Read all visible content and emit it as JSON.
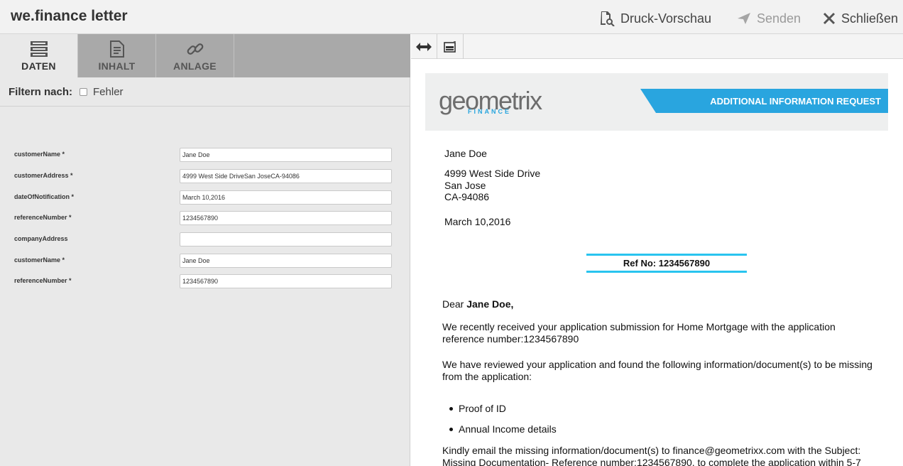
{
  "app": {
    "title": "we.finance letter"
  },
  "header": {
    "preview_label": "Druck-Vorschau",
    "send_label": "Senden",
    "close_label": "Schließen"
  },
  "tabs": [
    {
      "label": "DATEN",
      "icon": "database-icon",
      "active": true
    },
    {
      "label": "INHALT",
      "icon": "document-icon",
      "active": false
    },
    {
      "label": "ANLAGE",
      "icon": "link-icon",
      "active": false
    }
  ],
  "filter": {
    "label": "Filtern nach:",
    "option": "Fehler",
    "checked": false
  },
  "form": {
    "fields": [
      {
        "label": "customerName *",
        "value": "Jane Doe"
      },
      {
        "label": "customerAddress *",
        "value": "4999 West Side DriveSan JoseCA-94086"
      },
      {
        "label": "dateOfNotification *",
        "value": "March 10,2016"
      },
      {
        "label": "referenceNumber *",
        "value": "1234567890"
      },
      {
        "label": "companyAddress",
        "value": ""
      },
      {
        "label": "customerName *",
        "value": "Jane Doe"
      },
      {
        "label": "referenceNumber *",
        "value": "1234567890"
      }
    ]
  },
  "letter": {
    "logo_text": "geometrix",
    "logo_sub": "FINANCE",
    "banner_title": "ADDITIONAL INFORMATION REQUEST",
    "recipient_name": "Jane Doe",
    "address_line1": "4999 West Side Drive",
    "address_line2": "San Jose",
    "address_line3": "CA-94086",
    "date": "March 10,2016",
    "ref": "Ref No: 1234567890",
    "salutation_prefix": "Dear ",
    "salutation_name": "Jane Doe,",
    "paragraph1": "We recently received your application submission for Home Mortgage with the application reference number:1234567890",
    "paragraph2": "We have reviewed your application and found the following information/document(s) to be missing from the application:",
    "missing_items": [
      "Proof of ID",
      "Annual Income details"
    ],
    "paragraph3": "Kindly email the missing information/document(s) to finance@geometrixx.com with the Subject: Missing Documentation- Reference number:1234567890, to complete the application within 5-7"
  },
  "colors": {
    "accent": "#29a5df",
    "ref_border": "#29c4ef",
    "tab_bar": "#a9a9a9",
    "panel_bg": "#e9e9e9"
  }
}
